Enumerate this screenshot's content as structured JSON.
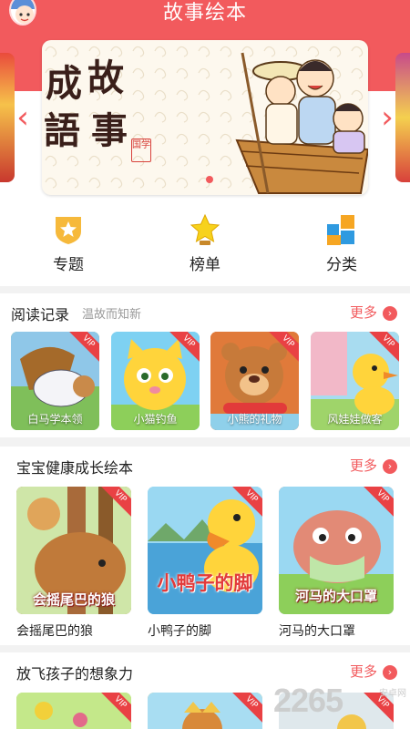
{
  "header": {
    "title": "故事绘本"
  },
  "banner": {
    "title_chars": [
      "成",
      "故",
      "語",
      "事"
    ],
    "seal": "国学"
  },
  "quick_menu": [
    {
      "label": "专题",
      "icon": "shield-star-icon"
    },
    {
      "label": "榜单",
      "icon": "trophy-star-icon"
    },
    {
      "label": "分类",
      "icon": "blocks-icon"
    }
  ],
  "reading_history": {
    "title": "阅读记录",
    "subtitle": "温故而知新",
    "more": "更多",
    "books": [
      {
        "caption": "白马学本领",
        "vip": "VIP"
      },
      {
        "caption": "小猫钓鱼",
        "vip": "VIP"
      },
      {
        "caption": "小熊的礼物",
        "vip": "VIP"
      },
      {
        "caption": "风娃娃做客",
        "vip": "VIP"
      }
    ]
  },
  "health_section": {
    "title": "宝宝健康成长绘本",
    "more": "更多",
    "books": [
      {
        "cover_text": "会摇尾巴的狼",
        "name": "会摇尾巴的狼",
        "vip": "VIP"
      },
      {
        "cover_text": "小鸭子的脚",
        "name": "小鸭子的脚",
        "vip": "VIP"
      },
      {
        "cover_text": "河马的大口罩",
        "name": "河马的大口罩",
        "vip": "VIP"
      }
    ]
  },
  "imagination_section": {
    "title": "放飞孩子的想象力",
    "more": "更多",
    "books": [
      {
        "vip": "VIP"
      },
      {
        "vip": "VIP"
      },
      {
        "vip": "VIP"
      }
    ]
  },
  "watermark": {
    "main": "2265",
    "sub": "安卓网"
  },
  "colors": {
    "brand": "#f25a5d",
    "vip": "#e94144"
  }
}
